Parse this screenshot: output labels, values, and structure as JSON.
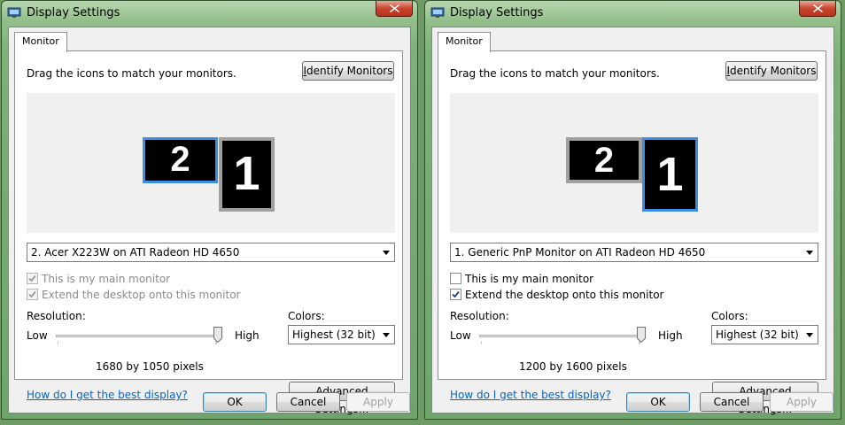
{
  "windows": [
    {
      "title": "Display Settings",
      "tab": "Monitor",
      "instruction": "Drag the icons to match your monitors.",
      "identify_button": "Identify Monitors",
      "monitors": [
        {
          "label": "2",
          "selected": true
        },
        {
          "label": "1",
          "selected": false
        }
      ],
      "display_select": "2. Acer X223W  on ATI Radeon HD 4650",
      "main_monitor": {
        "label": "This is my main monitor",
        "checked": true,
        "disabled": true
      },
      "extend_desktop": {
        "label": "Extend the desktop onto this monitor",
        "checked": true,
        "disabled": true
      },
      "resolution_label": "Resolution:",
      "low_label": "Low",
      "high_label": "High",
      "resolution_slider_fraction": 1.0,
      "resolution_text": "1680 by 1050 pixels",
      "colors_label": "Colors:",
      "colors_value": "Highest (32 bit)",
      "help_link": "How do I get the best display?",
      "advanced_button": "Advanced Settings...",
      "ok_button": "OK",
      "cancel_button": "Cancel",
      "apply_button": "Apply"
    },
    {
      "title": "Display Settings",
      "tab": "Monitor",
      "instruction": "Drag the icons to match your monitors.",
      "identify_button": "Identify Monitors",
      "monitors": [
        {
          "label": "2",
          "selected": false
        },
        {
          "label": "1",
          "selected": true
        }
      ],
      "display_select": "1. Generic PnP Monitor on ATI Radeon HD 4650",
      "main_monitor": {
        "label": "This is my main monitor",
        "checked": false,
        "disabled": false
      },
      "extend_desktop": {
        "label": "Extend the desktop onto this monitor",
        "checked": true,
        "disabled": false
      },
      "resolution_label": "Resolution:",
      "low_label": "Low",
      "high_label": "High",
      "resolution_slider_fraction": 1.0,
      "resolution_text": "1200 by 1600 pixels",
      "colors_label": "Colors:",
      "colors_value": "Highest (32 bit)",
      "help_link": "How do I get the best display?",
      "advanced_button": "Advanced Settings...",
      "ok_button": "OK",
      "cancel_button": "Cancel",
      "apply_button": "Apply"
    }
  ],
  "colors": {
    "selection_border": "#3a8ee8",
    "unselected_border": "#a0a0a0",
    "link": "#0066cc",
    "window_frame": "#7eb079"
  }
}
